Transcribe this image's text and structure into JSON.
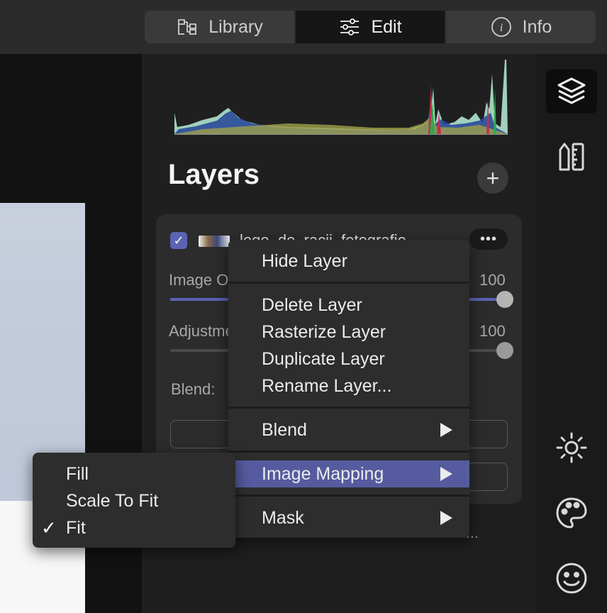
{
  "topbar": {
    "tabs": [
      {
        "label": "Library",
        "icon": "library-icon"
      },
      {
        "label": "Edit",
        "icon": "sliders-icon",
        "active": true
      },
      {
        "label": "Info",
        "icon": "info-icon"
      }
    ]
  },
  "layers": {
    "title": "Layers",
    "add_label": "+",
    "layer": {
      "name": "logo_de_racij_fotografie",
      "checked": true,
      "more_label": "•••"
    },
    "image_opacity": {
      "label": "Image Opacity",
      "value": "100",
      "fraction": 1.0
    },
    "adjustments": {
      "label": "Adjustments",
      "value": "100",
      "fraction": 1.0
    },
    "blend_label": "Blend:",
    "footer_text": "592..."
  },
  "context_menu": {
    "items": [
      {
        "label": "Hide Layer"
      },
      {
        "label": "Delete Layer"
      },
      {
        "label": "Rasterize Layer"
      },
      {
        "label": "Duplicate Layer"
      },
      {
        "label": "Rename Layer..."
      },
      {
        "label": "Blend",
        "submenu": true
      },
      {
        "label": "Image Mapping",
        "submenu": true,
        "highlighted": true
      },
      {
        "label": "Mask",
        "submenu": true
      }
    ]
  },
  "image_mapping_submenu": {
    "items": [
      {
        "label": "Fill",
        "checked": false
      },
      {
        "label": "Scale To Fit",
        "checked": false
      },
      {
        "label": "Fit",
        "checked": true
      }
    ],
    "check_glyph": "✓"
  },
  "sidebar": {
    "icons": [
      "layers-icon",
      "ruler-icon",
      "sun-icon",
      "palette-icon",
      "smiley-icon"
    ],
    "active": "layers-icon"
  },
  "colors": {
    "accent": "#5b63b3",
    "menu_highlight": "#555b9e",
    "panel_bg": "#1f1f1f",
    "card_bg": "#2c2c2c"
  }
}
